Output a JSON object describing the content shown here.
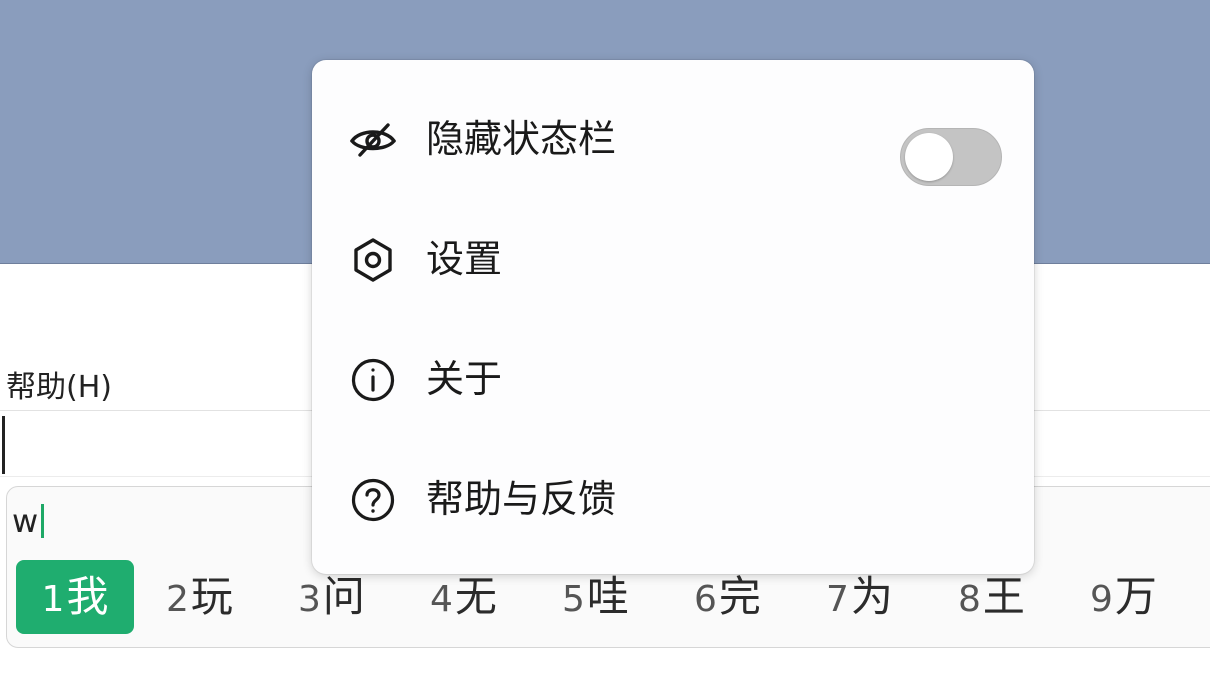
{
  "app_menu": {
    "help_label": "帮助(H)"
  },
  "ime": {
    "composition": "w",
    "candidates": [
      {
        "num": "1",
        "text": "我",
        "selected": true
      },
      {
        "num": "2",
        "text": "玩"
      },
      {
        "num": "3",
        "text": "问"
      },
      {
        "num": "4",
        "text": "无"
      },
      {
        "num": "5",
        "text": "哇"
      },
      {
        "num": "6",
        "text": "完"
      },
      {
        "num": "7",
        "text": "为"
      },
      {
        "num": "8",
        "text": "王"
      },
      {
        "num": "9",
        "text": "万"
      }
    ],
    "accent_color": "#1fad6f"
  },
  "context_menu": {
    "items": [
      {
        "label": "隐藏状态栏",
        "icon": "eye-off-icon",
        "toggle": {
          "on": false
        }
      },
      {
        "label": "设置",
        "icon": "settings-hex-icon"
      },
      {
        "label": "关于",
        "icon": "info-icon"
      },
      {
        "label": "帮助与反馈",
        "icon": "help-circle-icon"
      }
    ]
  },
  "colors": {
    "background_band": "#8a9dbd",
    "toggle_off": "#c4c4c4"
  }
}
